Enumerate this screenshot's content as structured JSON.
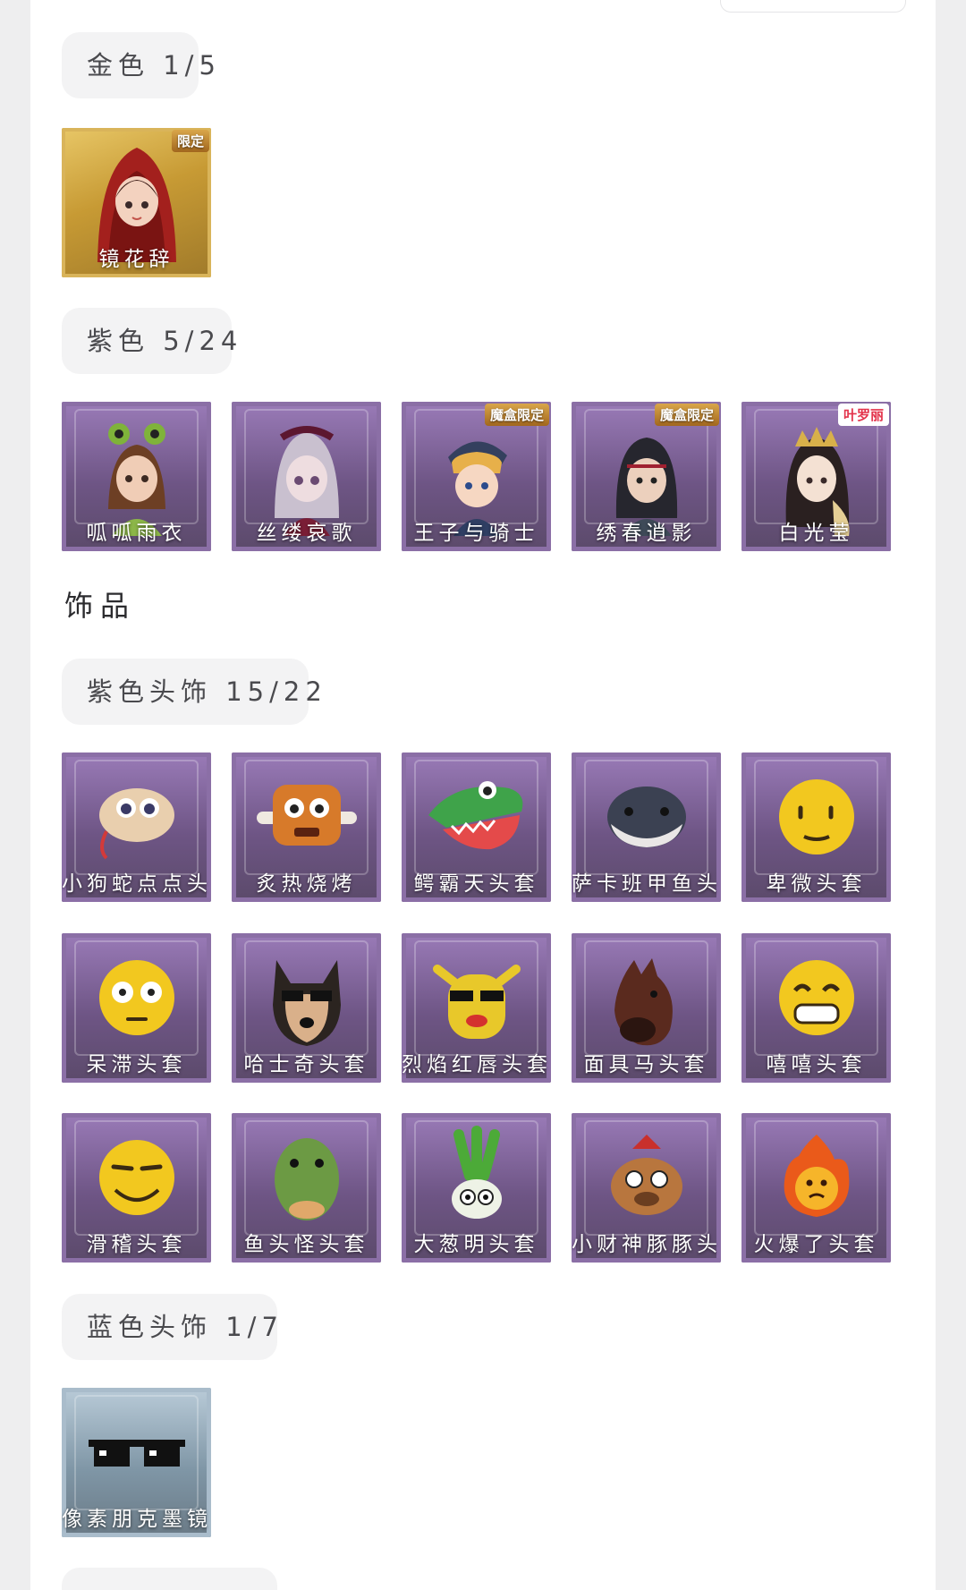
{
  "sections": {
    "gold": {
      "label": "金色 1/5"
    },
    "purple": {
      "label": "紫色 5/24"
    },
    "accessories_heading": "饰品",
    "purple_head": {
      "label": "紫色头饰 15/22"
    },
    "blue_head": {
      "label": "蓝色头饰 1/7"
    }
  },
  "gold_items": [
    {
      "name": "镜花辞",
      "badge": "限定",
      "icon": "hooded-girl-portrait"
    }
  ],
  "purple_items": [
    {
      "name": "呱呱雨衣",
      "badge": "",
      "icon": "frog-hood-girl-portrait"
    },
    {
      "name": "丝缕哀歌",
      "badge": "",
      "icon": "lace-doll-portrait"
    },
    {
      "name": "王子与骑士",
      "badge": "魔盒限定",
      "icon": "prince-knight-portrait"
    },
    {
      "name": "绣春逍影",
      "badge": "魔盒限定",
      "icon": "swordsman-portrait"
    },
    {
      "name": "白光莹",
      "badge": "叶罗丽",
      "icon": "crowned-lady-portrait"
    }
  ],
  "purple_head_items": [
    {
      "name": "小狗蛇点点头",
      "icon": "snake-head-icon"
    },
    {
      "name": "炙热烧烤",
      "icon": "barbecue-head-icon"
    },
    {
      "name": "鳄霸天头套",
      "icon": "crocodile-head-icon"
    },
    {
      "name": "萨卡班甲鱼头",
      "icon": "fish-head-icon"
    },
    {
      "name": "卑微头套",
      "icon": "humble-emoji-icon"
    },
    {
      "name": "呆滞头套",
      "icon": "dazed-emoji-icon"
    },
    {
      "name": "哈士奇头套",
      "icon": "husky-head-icon"
    },
    {
      "name": "烈焰红唇头套",
      "icon": "red-lips-head-icon"
    },
    {
      "name": "面具马头套",
      "icon": "horse-mask-icon"
    },
    {
      "name": "嘻嘻头套",
      "icon": "grin-emoji-icon"
    },
    {
      "name": "滑稽头套",
      "icon": "funny-emoji-icon"
    },
    {
      "name": "鱼头怪头套",
      "icon": "fish-monster-head-icon"
    },
    {
      "name": "大葱明头套",
      "icon": "scallion-head-icon"
    },
    {
      "name": "小财神豚豚头",
      "icon": "capybara-head-icon"
    },
    {
      "name": "火爆了头套",
      "icon": "fire-head-icon"
    }
  ],
  "blue_head_items": [
    {
      "name": "像素朋克墨镜",
      "icon": "pixel-sunglasses-icon"
    }
  ],
  "colors": {
    "gold": "#c79a34",
    "purple": "#6e5585",
    "blue": "#7f96a6",
    "pill_bg": "#f3f3f4"
  }
}
